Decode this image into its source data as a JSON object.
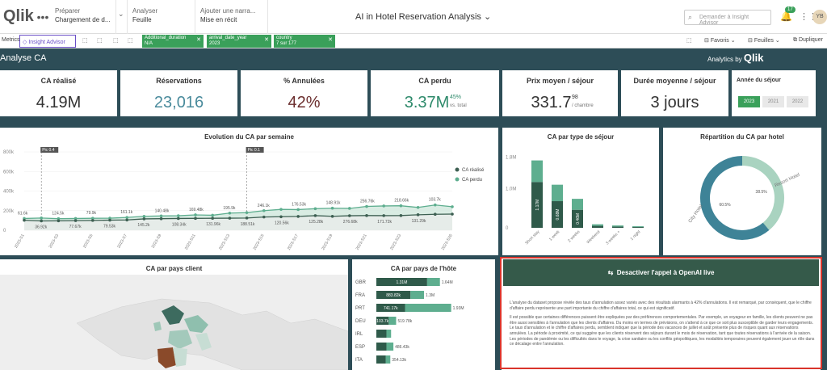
{
  "topbar": {
    "logo": "Qlik",
    "steps": [
      {
        "label": "Préparer",
        "value": "Chargement de d..."
      },
      {
        "label": "Analyser",
        "value": "Feuille"
      },
      {
        "label": "Ajouter une narra...",
        "value": "Mise en récit"
      }
    ],
    "app_title": "AI in Hotel Reservation Analysis",
    "search_placeholder": "Demander à Insight Advisor",
    "notifications": "17",
    "avatar": "YB"
  },
  "toolbar": {
    "metrics": "Metrics",
    "insight_advisor": "Insight Advisor",
    "filters": [
      {
        "field": "Additional_duration",
        "value": "N/A"
      },
      {
        "field": "arrival_date_year",
        "value": "2023"
      },
      {
        "field": "country",
        "value": "7 sur 177"
      }
    ],
    "bookmarks": "Favoris",
    "sheets": "Feuilles",
    "duplicate": "Dupliquer"
  },
  "sheet": {
    "title": "Analyse CA",
    "analytics_by": "Analytics by",
    "brand": "Qlik"
  },
  "kpis": [
    {
      "label": "CA réalisé",
      "value": "4.19M",
      "color": "#333333"
    },
    {
      "label": "Réservations",
      "value": "23,016",
      "color": "#4a8b9c"
    },
    {
      "label": "% Annulées",
      "value": "42%",
      "color": "#6b2e2e"
    },
    {
      "label": "CA perdu",
      "value": "3.37M",
      "color": "#2e8a6b",
      "sub_value": "45%",
      "sub_label": "vs. total"
    },
    {
      "label": "Prix moyen / séjour",
      "value": "331.7",
      "color": "#333333",
      "sub_value": "98",
      "sub_label": "/ chambre"
    },
    {
      "label": "Durée moyenne / séjour",
      "value": "3 jours",
      "color": "#333333"
    }
  ],
  "year_selector": {
    "label": "Année du séjour",
    "years": [
      "2023",
      "2021",
      "2022"
    ],
    "selected": "2023"
  },
  "chart_data": [
    {
      "type": "line",
      "title": "Evolution du CA par semaine",
      "categories": [
        "2023-S1",
        "2023-S2",
        "2023-S3",
        "2023-S4",
        "2023-S5",
        "2023-S6",
        "2023-S7",
        "2023-S8",
        "2023-S9",
        "2023-S10",
        "2023-S11",
        "2023-S12",
        "2023-S13",
        "2023-S14",
        "2023-S15",
        "2023-S16",
        "2023-S17",
        "2023-S18",
        "2023-S19",
        "2023-S20",
        "2023-S21",
        "2023-S22",
        "2023-S23",
        "2023-S24",
        "2023-S25",
        "2023-S26"
      ],
      "x_tick_labels": [
        "2023-S1",
        "2023-S3",
        "2023-S5",
        "2023-S7",
        "2023-S9",
        "2023-S11",
        "2023-S13",
        "2023-S15",
        "2023-S17",
        "2023-S19",
        "2023-S21",
        "2023-S23",
        "2023-S26"
      ],
      "series": [
        {
          "name": "CA réalisé",
          "color": "#3d5f52",
          "values": [
            102,
            95,
            96,
            98,
            100,
            103,
            105,
            116,
            118,
            120,
            121,
            122,
            123,
            125,
            135,
            138,
            141,
            149,
            142,
            148,
            150,
            149,
            150,
            158,
            163,
            165
          ]
        },
        {
          "name": "CA perdu",
          "color": "#5eae8f",
          "values": [
            120,
            125,
            118,
            120,
            122,
            123,
            131,
            142,
            146,
            148,
            157,
            153,
            175,
            180,
            200,
            213,
            211,
            220,
            225,
            223,
            243,
            248,
            250,
            233,
            258,
            240
          ]
        }
      ],
      "data_labels": [
        "61.6k",
        "36.92k",
        "124.5k",
        "77.67k",
        "79.9k",
        "79.53k",
        "161.1k",
        "145.2k",
        "140.48k",
        "108.34k",
        "169.48k",
        "131.96k",
        "195.9k",
        "188.51k",
        "246.1k",
        "120.56k",
        "176.53k",
        "125.28k",
        "148.91k",
        "276.68k",
        "256.76k",
        "171.72k",
        "218.66k",
        "131.29k",
        "103.7k"
      ],
      "annotations": [
        "Pic 0.4",
        "Pic 0.1"
      ],
      "yticks": [
        "0",
        "200k",
        "400k",
        "600k",
        "800k"
      ],
      "ylim": [
        0,
        800
      ],
      "legend": "right"
    },
    {
      "type": "bar",
      "title": "CA par type de séjour",
      "categories": [
        "Short stay",
        "1 week",
        "2 weeks",
        "Weekend",
        "3 weeks +",
        "1 night"
      ],
      "series": [
        {
          "name": "CA réalisé",
          "color": "#2f5a4a",
          "values": [
            1.17,
            0.68,
            0.46,
            0.05,
            0.03,
            0.02
          ]
        },
        {
          "name": "CA perdu",
          "color": "#5eae8f",
          "values": [
            0.55,
            0.42,
            0.28,
            0.04,
            0.03,
            0.02
          ]
        }
      ],
      "yticks": [
        "0",
        "1.0M",
        "1.8M"
      ],
      "ylim": [
        0,
        2.0
      ]
    },
    {
      "type": "pie",
      "title": "Répartition du CA par hotel",
      "categories": [
        "Resort Hotel",
        "City Hotel"
      ],
      "values": [
        38.5,
        60.5
      ],
      "colors": [
        "#a9d3c0",
        "#3e8397"
      ]
    },
    {
      "type": "bar",
      "title": "CA par pays de l'hôte",
      "categories": [
        "GBR",
        "FRA",
        "PRT",
        "DEU",
        "IRL",
        "ESP",
        "ITA"
      ],
      "series": [
        {
          "name": "CA réalisé",
          "color": "#2f5a4a",
          "values": [
            1.31,
            0.88,
            0.74,
            0.32,
            0.26,
            0.26,
            0.24
          ]
        },
        {
          "name": "CA perdu",
          "color": "#5eae8f",
          "values": [
            0.33,
            0.35,
            1.19,
            0.19,
            0.12,
            0.18,
            0.12
          ]
        }
      ],
      "labels_left": [
        "1.31M",
        "883.82k",
        "741.17k",
        "103.7k",
        "",
        "",
        ""
      ],
      "labels_right": [
        "1.64M",
        "1.3M",
        "1.93M",
        "519.78k",
        "",
        "486.43k",
        "354.13k"
      ]
    }
  ],
  "map_panel": {
    "title": "CA par pays client"
  },
  "openai": {
    "button_label": "Desactiver l'appel à OpenAI live",
    "paragraph1": "L'analyse du dataset propose révèle des taux d'annulation assez variés avec des résultats alarmants à 42% d'annulations. Il est remarqué, par conséquent, que le chiffre d'affaire perdu représente une part importante du chiffre d'affaires total, ce qui est significatif.",
    "paragraph2": "Il est possible que certaines différences puissent être expliquées par des préférences comportementales. Par exemple, un voyageur en famille, les clients peuvent ne pas être aussi sensibles à l'annulation que les clients d'affaires. Du moins en termes de prévisions, on s'attend à ce que ce soit plus susceptible de garder leurs engagements. Le taux d'annulation et le chiffre d'affaires perdu, semblent indiquer que la période des vacances de juillet et août présente plus de risques quant aux réservations annulées. La période à proximité, ce qui suggère que les clients réservent des séjours durant le mois de réservation, tant que toutes réservations à l'arrivée de la saison. Les périodes de pandémie ou les difficultés dans le voyage, la crise sanitaire ou les conflits géopolitiques, les modalités temporaires peuvent également jouer un rôle dans ce décalage entre l'annulation."
  },
  "colors": {
    "background": "#2d4d57",
    "accent_green": "#3aa05a",
    "dark_green": "#2f5a4a",
    "light_green": "#5eae8f",
    "teal": "#3e8397",
    "highlight_red": "#d9342b"
  }
}
